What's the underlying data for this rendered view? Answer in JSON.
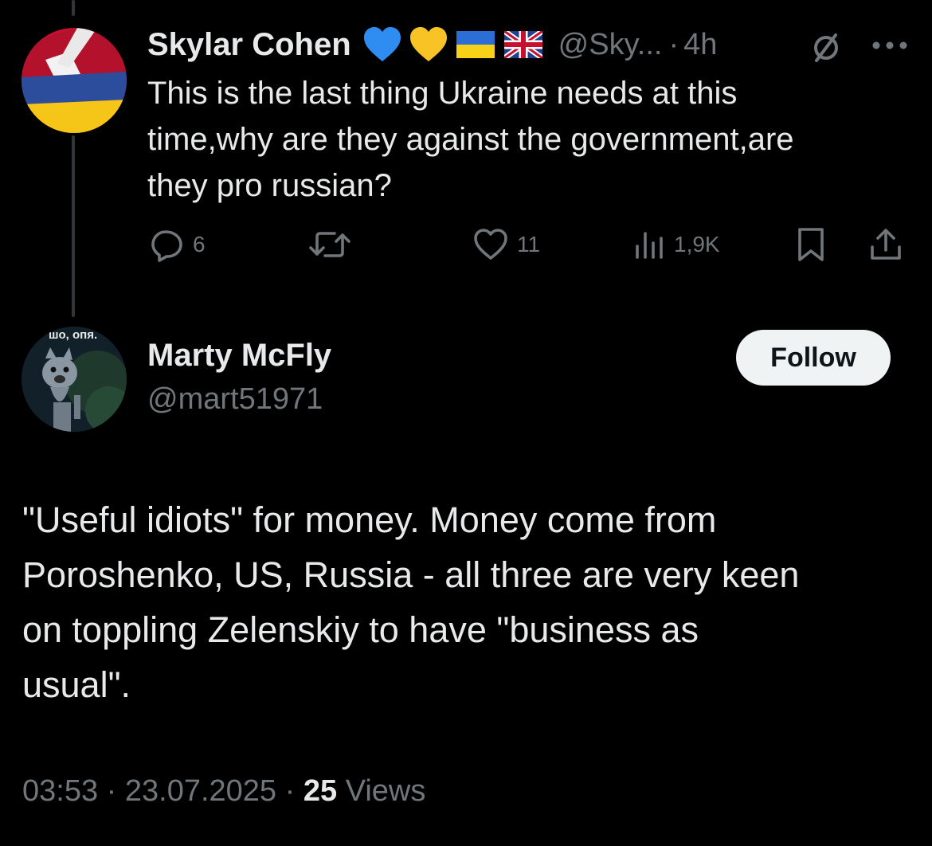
{
  "parent_tweet": {
    "author_name": "Skylar Cohen",
    "name_emoji": [
      "blue-heart",
      "yellow-heart",
      "ukraine-flag",
      "uk-flag"
    ],
    "handle": "@Sky...",
    "separator": "·",
    "time": "4h",
    "text_lines": [
      "This is the last thing Ukraine needs at this",
      "time,why are they against the government,are",
      "they pro russian?"
    ],
    "actions": {
      "replies": "6",
      "retweets": "",
      "likes": "11",
      "views": "1,9K"
    }
  },
  "main_tweet": {
    "author_name": "Marty McFly",
    "handle": "@mart51971",
    "avatar_caption": "шо, опя.",
    "follow_label": "Follow",
    "text_lines": [
      "\"Useful idiots\" for money. Money come from",
      "Poroshenko, US, Russia - all three are very keen",
      "on toppling Zelenskiy to have \"business as",
      "usual\"."
    ],
    "meta": {
      "time": "03:53",
      "sep1": "·",
      "date": "23.07.2025",
      "sep2": "·",
      "views_count": "25",
      "views_label": "Views"
    }
  },
  "colors": {
    "background": "#000000",
    "text": "#e7e9ea",
    "muted": "#71767b",
    "thread_line": "#333639",
    "follow_bg": "#eff3f4"
  }
}
